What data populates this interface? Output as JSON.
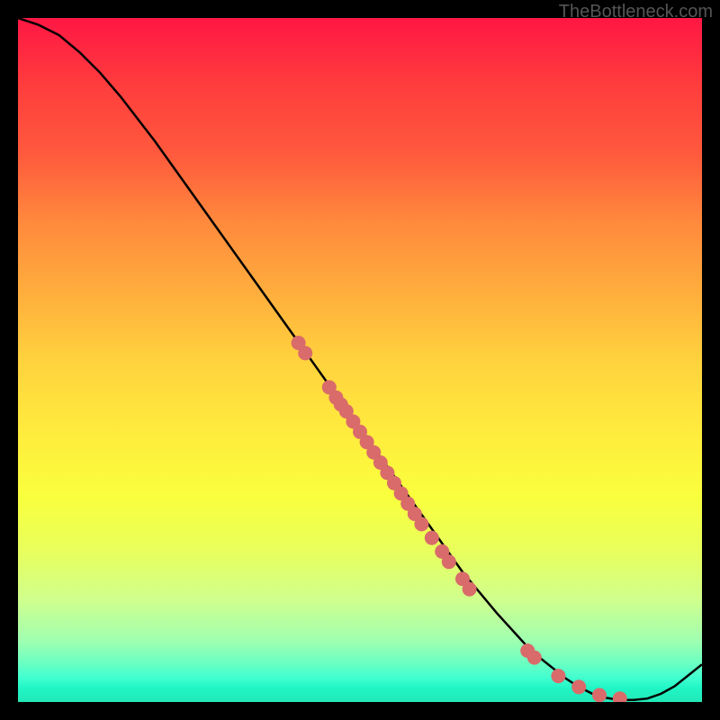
{
  "watermark": "TheBottleneck.com",
  "chart_data": {
    "type": "line",
    "title": "",
    "xlabel": "",
    "ylabel": "",
    "xlim": [
      0,
      100
    ],
    "ylim": [
      0,
      100
    ],
    "series": [
      {
        "name": "curve",
        "x": [
          0,
          3,
          6,
          9,
          12,
          15,
          20,
          25,
          30,
          35,
          40,
          45,
          50,
          55,
          60,
          65,
          70,
          75,
          80,
          82,
          84,
          86,
          88,
          90,
          92,
          94,
          96,
          100
        ],
        "y": [
          100,
          99,
          97.5,
          95,
          92,
          88.5,
          82,
          75,
          68,
          61,
          54,
          47,
          40,
          33,
          26,
          19,
          13,
          7.5,
          3.5,
          2.2,
          1.2,
          0.6,
          0.3,
          0.3,
          0.5,
          1.2,
          2.3,
          5.5
        ]
      }
    ],
    "scatter_points": {
      "name": "markers",
      "color": "#d96b6b",
      "points": [
        {
          "x": 41,
          "y": 52.5
        },
        {
          "x": 42,
          "y": 51
        },
        {
          "x": 45.5,
          "y": 46
        },
        {
          "x": 46.5,
          "y": 44.5
        },
        {
          "x": 47.2,
          "y": 43.5
        },
        {
          "x": 48,
          "y": 42.5
        },
        {
          "x": 49,
          "y": 41
        },
        {
          "x": 50,
          "y": 39.5
        },
        {
          "x": 51,
          "y": 38
        },
        {
          "x": 52,
          "y": 36.5
        },
        {
          "x": 53,
          "y": 35
        },
        {
          "x": 54,
          "y": 33.5
        },
        {
          "x": 55,
          "y": 32
        },
        {
          "x": 56,
          "y": 30.5
        },
        {
          "x": 57,
          "y": 29
        },
        {
          "x": 58,
          "y": 27.5
        },
        {
          "x": 59,
          "y": 26
        },
        {
          "x": 60.5,
          "y": 24
        },
        {
          "x": 62,
          "y": 22
        },
        {
          "x": 63,
          "y": 20.5
        },
        {
          "x": 65,
          "y": 18
        },
        {
          "x": 66,
          "y": 16.5
        },
        {
          "x": 74.5,
          "y": 7.5
        },
        {
          "x": 75.5,
          "y": 6.5
        },
        {
          "x": 79,
          "y": 3.8
        },
        {
          "x": 82,
          "y": 2.2
        },
        {
          "x": 85,
          "y": 1.0
        },
        {
          "x": 88,
          "y": 0.5
        }
      ]
    }
  }
}
